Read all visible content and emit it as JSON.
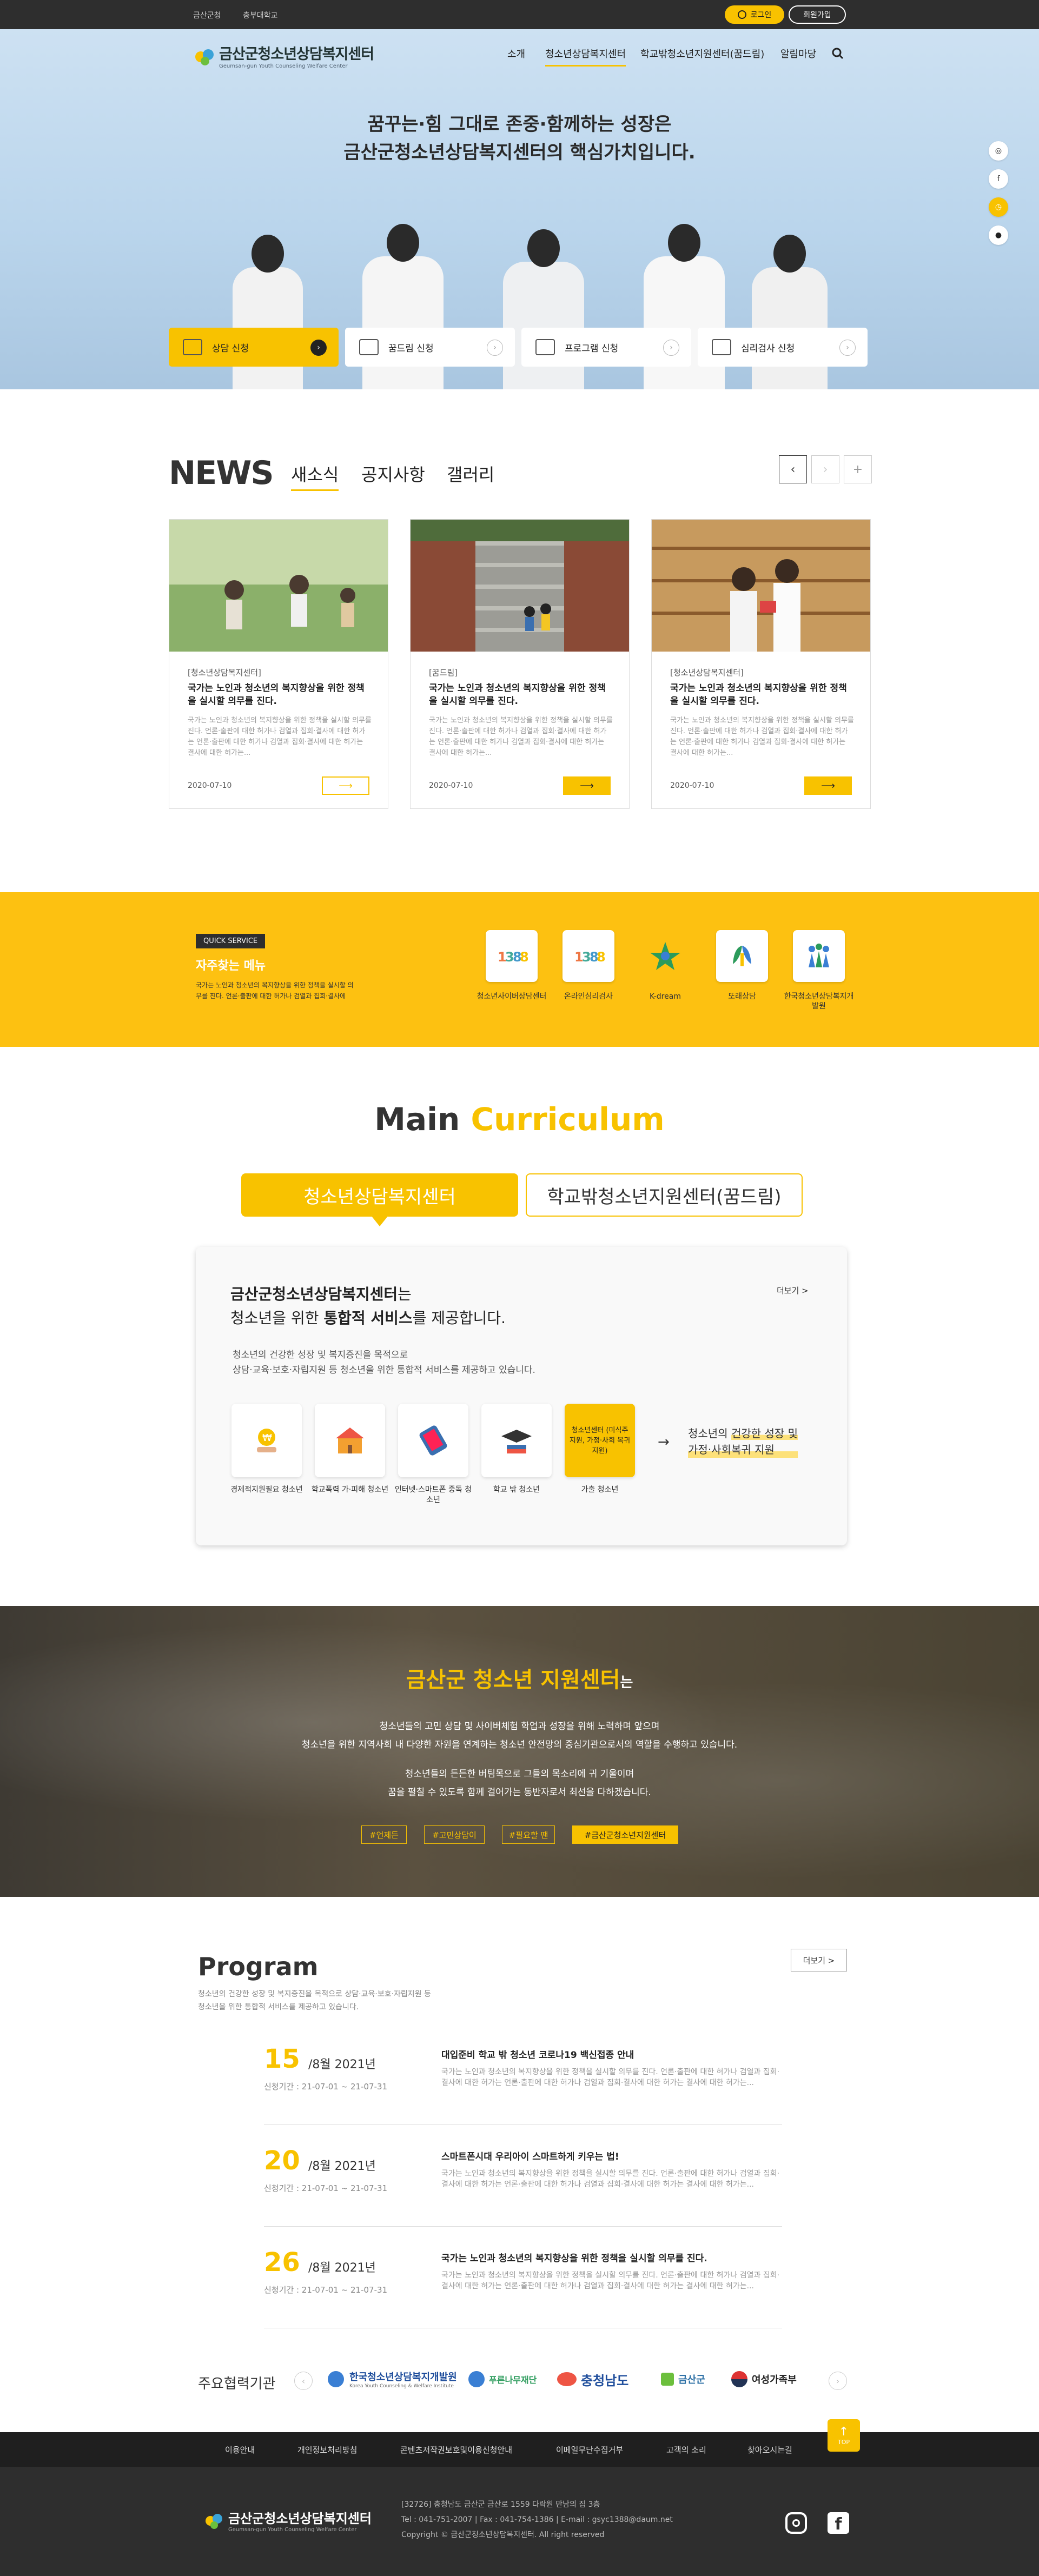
{
  "topbar": {
    "links": [
      "금산군청",
      "충부대학교"
    ],
    "login": "로그인",
    "join": "회원가입"
  },
  "header": {
    "logo_title": "금산군청소년상담복지센터",
    "logo_sub": "Geumsan-gun Youth Counseling Welfare Center",
    "menu": [
      "소개",
      "청소년상담복지센터",
      "학교밖청소년지원센터(꿈드림)",
      "알림마당"
    ]
  },
  "hero": {
    "line1": "꿈꾸는·힘 그대로 존중·함께하는 성장은",
    "line2": "금산군청소년상담복지센터의 핵심가치입니다.",
    "buttons": [
      "상담 신청",
      "꿈드림 신청",
      "프로그램 신청",
      "심리검사 신청"
    ]
  },
  "news": {
    "heading": "NEWS",
    "tabs": [
      "새소식",
      "공지사항",
      "갤러리"
    ],
    "cards": [
      {
        "category": "[청소년상담복지센터]",
        "title": "국가는 노인과 청소년의 복지향상을 위한 정책을 실시할 의무를 진다.",
        "desc": "국가는 노인과 청소년의 복지향상을 위한 정책을 실시할 의무를 진다. 언론·출판에 대한 허가나 검열과 집회·결사에 대한 허가는 언론·출판에 대한 허가나 검열과 집회·결사에 대한 허가는 결사에 대한 허가는...",
        "date": "2020-07-10"
      },
      {
        "category": "[꿈드림]",
        "title": "국가는 노인과 청소년의 복지향상을 위한 정책을 실시할 의무를 진다.",
        "desc": "국가는 노인과 청소년의 복지향상을 위한 정책을 실시할 의무를 진다. 언론·출판에 대한 허가나 검열과 집회·결사에 대한 허가는 언론·출판에 대한 허가나 검열과 집회·결사에 대한 허가는 결사에 대한 허가는...",
        "date": "2020-07-10"
      },
      {
        "category": "[청소년상담복지센터]",
        "title": "국가는 노인과 청소년의 복지향상을 위한 정책을 실시할 의무를 진다.",
        "desc": "국가는 노인과 청소년의 복지향상을 위한 정책을 실시할 의무를 진다. 언론·출판에 대한 허가나 검열과 집회·결사에 대한 허가는 언론·출판에 대한 허가나 검열과 집회·결사에 대한 허가는 결사에 대한 허가는...",
        "date": "2020-07-10"
      }
    ]
  },
  "quick": {
    "badge": "QUICK SERVICE",
    "title": "자주찾는 메뉴",
    "desc": "국가는 노인과 청소년의 복지향상을 위한 정책을 실시할 의무를 진다. 언론·출판에 대한 허가나 검열과 집회·결사에",
    "items": [
      "청소년사이버상담센터",
      "온라인심리검사",
      "K-dream",
      "또래상담",
      "한국청소년상담복지개발원"
    ]
  },
  "curriculum": {
    "heading_a": "Main",
    "heading_b": "Curriculum",
    "tabs": [
      "청소년상담복지센터",
      "학교밖청소년지원센터(꿈드림)"
    ],
    "title_a": "금산군청소년상담복지센터",
    "title_b": "는",
    "line2_a": "청소년을 위한",
    "line2_b": "통합적 서비스",
    "line2_c": "를 제공합니다.",
    "more": "더보기 >",
    "desc1": "청소년의 건강한 성장 및 복지증진을 목적으로",
    "desc2": "상담·교육·보호·자립지원 등 청소년을 위한 통합적 서비스를 제공하고 있습니다.",
    "items": [
      "경제적지원필요 청소년",
      "학교폭력 가·피해 청소년",
      "인터넷·스마트폰 중독 청소년",
      "학교 밖 청소년",
      "가출 청소년"
    ],
    "highlight": "청소년센터 (미식주지원, 가정·사회 복귀지원)",
    "result_a": "청소년의",
    "result_b": "건강한 성장 및",
    "result_c": "가정·사회복귀 지원"
  },
  "center": {
    "title_a": "금산군 청소년 지원센터",
    "title_b": "는",
    "p1": "청소년들의 고민 상담 및 사이버체험 학업과 성장을 위해 노력하며 앞으며",
    "p2": "청소년을 위한 지역사회 내 다양한 자원을 연계하는 청소년 안전망의 중심기관으로서의 역할을 수행하고 있습니다.",
    "p3": "청소년들의 든든한 버팀목으로 그들의 목소리에 귀 기울이며",
    "p4": "꿈을 펼칠 수 있도록 함께 걸어가는 동반자로서 최선을 다하겠습니다.",
    "tags": [
      "#언제든",
      "#고민상담이",
      "#필요할 땐",
      "#금산군청소년지원센터"
    ]
  },
  "program": {
    "heading": "Program",
    "desc1": "청소년의 건강한 성장 및 복지증진을 목적으로 상담·교육·보호·자립지원 등",
    "desc2": "청소년을 위한 통합적 서비스를 제공하고 있습니다.",
    "more": "더보기 >",
    "items": [
      {
        "day": "15",
        "month": "/8월 2021년",
        "period": "신청기간 : 21-07-01 ~ 21-07-31",
        "title": "대입준비 학교 밖 청소년 코로나19 백신접종 안내",
        "desc": "국가는 노인과 청소년의 복지향상을 위한 정책을 실시할 의무를 진다. 언론·출판에 대한 허가나 검열과 집회·결사에 대한 허가는 언론·출판에 대한 허가나 검열과 집회·결사에 대한 허가는 결사에 대한 허가는..."
      },
      {
        "day": "20",
        "month": "/8월 2021년",
        "period": "신청기간 : 21-07-01 ~ 21-07-31",
        "title": "스마트폰시대 우리아이 스마트하게 키우는 법!",
        "desc": "국가는 노인과 청소년의 복지향상을 위한 정책을 실시할 의무를 진다. 언론·출판에 대한 허가나 검열과 집회·결사에 대한 허가는 언론·출판에 대한 허가나 검열과 집회·결사에 대한 허가는 결사에 대한 허가는..."
      },
      {
        "day": "26",
        "month": "/8월 2021년",
        "period": "신청기간 : 21-07-01 ~ 21-07-31",
        "title": "국가는 노인과 청소년의 복지향상을 위한 정책을 실시할 의무를 진다.",
        "desc": "국가는 노인과 청소년의 복지향상을 위한 정책을 실시할 의무를 진다. 언론·출판에 대한 허가나 검열과 집회·결사에 대한 허가는 언론·출판에 대한 허가나 검열과 집회·결사에 대한 허가는 결사에 대한 허가는..."
      }
    ]
  },
  "partners": {
    "label": "주요협력기관",
    "items": [
      "한국청소년상담복지개발원",
      "푸른나무재단",
      "충청남도",
      "금산군",
      "여성가족부"
    ],
    "items_sub": "Korea Youth Counseling & Welfare Institute"
  },
  "footer": {
    "menu": [
      "이용안내",
      "개인정보처리방침",
      "콘텐츠저작권보호및이용신청안내",
      "이메일무단수집거부",
      "고객의 소리",
      "찾아오시는길"
    ],
    "addr": "[32726] 충청남도 금산군 금산로 1559 다락원 만남의 집 3층",
    "tel": "Tel : 041-751-2007 | Fax : 041-754-1386 | E-mail : gsyc1388@daum.net",
    "copy": "Copyright © 금산군청소년상담복지센터. All right reserved",
    "top": "TOP",
    "logo_title": "금산군청소년상담복지센터",
    "logo_sub": "Geumsan-gun Youth Counseling Welfare Center"
  }
}
